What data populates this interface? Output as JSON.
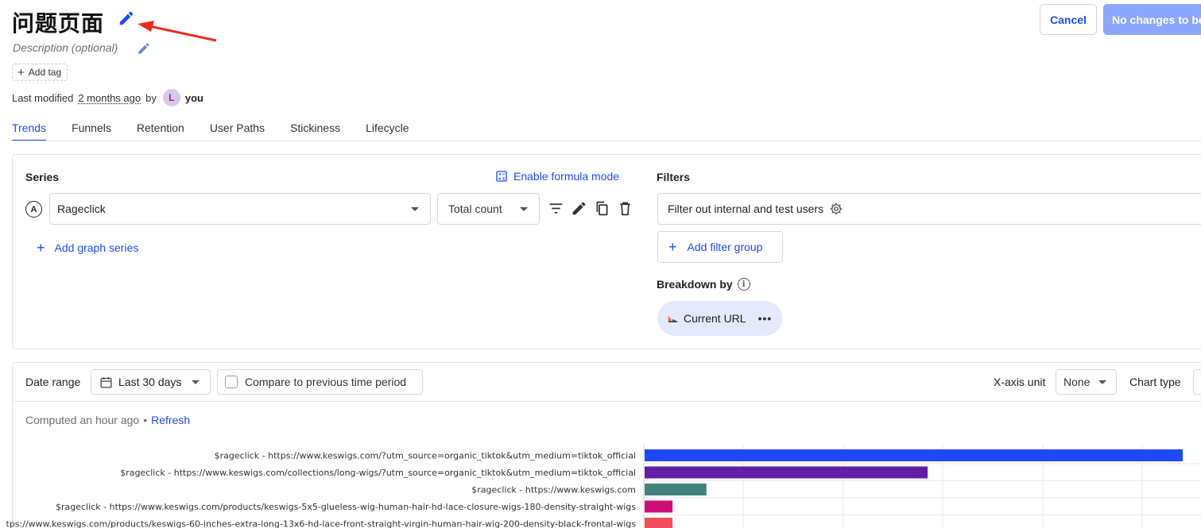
{
  "insight": {
    "title": "问题页面",
    "description_placeholder": "Description (optional)",
    "add_tag_label": "Add tag",
    "modified_prefix": "Last modified",
    "modified_relative": "2 months ago",
    "modified_by": "by",
    "author_initial": "L",
    "author_name": "you"
  },
  "actions": {
    "cancel_label": "Cancel",
    "save_label": "No changes to be saved"
  },
  "tabs": [
    {
      "label": "Trends",
      "active": true
    },
    {
      "label": "Funnels"
    },
    {
      "label": "Retention"
    },
    {
      "label": "User Paths"
    },
    {
      "label": "Stickiness"
    },
    {
      "label": "Lifecycle"
    }
  ],
  "series": {
    "heading": "Series",
    "formula_label": "Enable formula mode",
    "items": [
      {
        "letter": "A",
        "event": "Rageclick",
        "math": "Total count"
      }
    ],
    "add_label": "Add graph series"
  },
  "filters": {
    "heading": "Filters",
    "test_accounts_label": "Filter out internal and test users",
    "add_group_label": "Add filter group",
    "breakdown_heading": "Breakdown by",
    "breakdown_value": "Current URL",
    "more_label": "•••"
  },
  "chart_controls": {
    "date_range_label": "Date range",
    "date_range_value": "Last 30 days",
    "compare_label": "Compare to previous time period",
    "x_axis_unit_label": "X-axis unit",
    "x_axis_unit_value": "None",
    "chart_type_label": "Chart type",
    "computed_label": "Computed an hour ago",
    "separator": "•",
    "refresh_label": "Refresh"
  },
  "colors": {
    "accent": "#1d4aff",
    "bar_colors": [
      "#1d4aff",
      "#621da6",
      "#42827e",
      "#ce0e74",
      "#f14f58"
    ]
  },
  "chart_data": {
    "type": "bar",
    "orientation": "horizontal",
    "categories": [
      "$rageclick - https://www.keswigs.com/?utm_source=organic_tiktok&utm_medium=tiktok_official",
      "$rageclick - https://www.keswigs.com/collections/long-wigs/?utm_source=organic_tiktok&utm_medium=tiktok_official",
      "$rageclick - https://www.keswigs.com",
      "$rageclick - https://www.keswigs.com/products/keswigs-5x5-glueless-wig-human-hair-hd-lace-closure-wigs-180-density-straight-wigs",
      "tps://www.keswigs.com/products/keswigs-60-inches-extra-long-13x6-hd-lace-front-straight-virgin-human-hair-wig-200-density-black-frontal-wigs"
    ],
    "values": [
      27,
      14.2,
      3.1,
      1.4,
      1.4
    ],
    "xlim": [
      0,
      28
    ],
    "grid": true
  }
}
